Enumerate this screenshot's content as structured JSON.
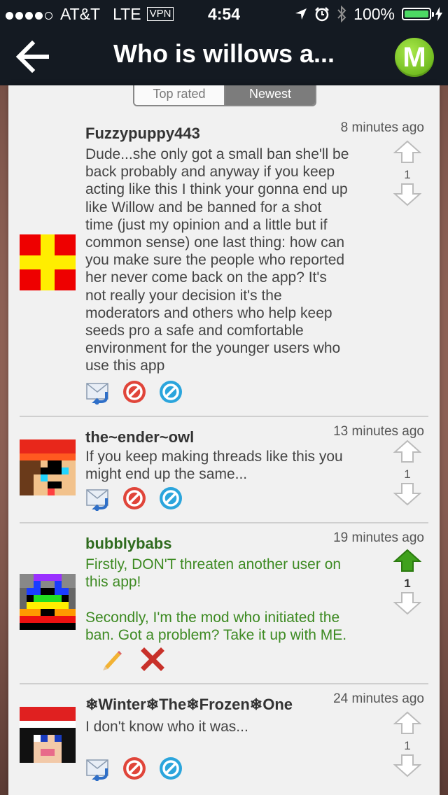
{
  "status_bar": {
    "carrier": "AT&T",
    "network": "LTE",
    "vpn": "VPN",
    "time": "4:54",
    "battery": "100%",
    "signal_filled": 4,
    "signal_total": 5,
    "icons": [
      "location-icon",
      "alarm-icon",
      "bluetooth-icon",
      "battery-icon",
      "charging-icon"
    ]
  },
  "nav": {
    "title": "Who is willows a...",
    "back_icon": "back-arrow-icon",
    "logo_letter": "M"
  },
  "sort_tabs": [
    {
      "label": "Top rated",
      "active": false
    },
    {
      "label": "Newest",
      "active": true
    }
  ],
  "comments": [
    {
      "author": "Fuzzypuppy443",
      "time": "8 minutes ago",
      "text": "Dude...she only got a small ban she'll be\nback probably and anyway if you keep\nacting like this I think your gonna end up\nlike Willow and be banned for a shot\ntime (just my opinion and a little but if\ncommon sense) one last thing: how can\nyou make sure the people who reported\nher never come back on the app? It's\nnot really your decision it's the\nmoderators and others who help keep\nseeds pro a safe and comfortable\nenvironment for the younger users who\nuse this app",
      "votes": "1",
      "upvoted": false,
      "actions": [
        "reply-icon",
        "report-icon",
        "block-icon"
      ]
    },
    {
      "author": "the~ender~owl",
      "time": "13 minutes ago",
      "text": "If you keep making threads like this you\nmight end up the same...",
      "votes": "1",
      "upvoted": false,
      "actions": [
        "reply-icon",
        "report-icon",
        "block-icon"
      ]
    },
    {
      "author": "bubblybabs",
      "time": "19 minutes ago",
      "text": "Firstly, DON'T threaten another user on\nthis app!\n\nSecondly, I'm the mod who initiated the\nban. Got a problem? Take it up with ME.",
      "votes": "1",
      "upvoted": true,
      "actions": [
        "edit-icon",
        "delete-icon"
      ]
    },
    {
      "author": "❄Winter❄The❄Frozen❄One",
      "time": "24 minutes ago",
      "text": "I don't know who it was...",
      "votes": "1",
      "upvoted": false,
      "actions": [
        "reply-icon",
        "report-icon",
        "block-icon"
      ]
    }
  ],
  "colors": {
    "bar_bg": "#141a22",
    "logo_green": "#7cc623",
    "mod_text": "#3d8a22",
    "upvote_green": "#3fa11c",
    "report_red": "#e0453a",
    "block_blue": "#2ba5dc"
  }
}
